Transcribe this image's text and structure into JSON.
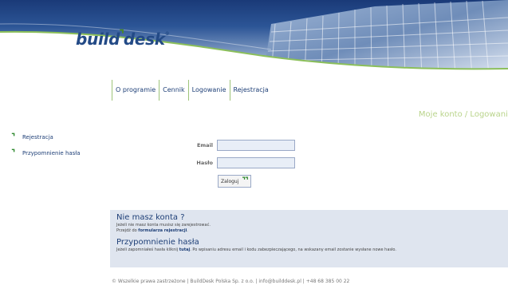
{
  "header": {
    "logo_main": "build",
    "logo_tail": "desk",
    "logo_reg": "®"
  },
  "nav": {
    "items": [
      "O programie",
      "Cennik",
      "Logowanie",
      "Rejestracja"
    ]
  },
  "breadcrumb": "Moje konto / Logowanie",
  "sidebar": {
    "items": [
      "Rejestracja",
      "Przypomnienie hasła"
    ]
  },
  "login": {
    "email_label": "Email",
    "email_value": "",
    "password_label": "Hasło",
    "password_value": "",
    "button_label": "Zaloguj"
  },
  "info": {
    "title1": "Nie masz konta ?",
    "text1": "Jeżeli nie masz konta musisz się zarejestrować.",
    "text2_prefix": "Przejdź do",
    "text2_link": "formularza rejestracji",
    "title2": "Przypomnienie hasła",
    "text3_prefix": "Jeżeli zapomniałeś hasła kliknij",
    "text3_link": "tutaj",
    "text3_suffix": ". Po wpisaniu adresu email i kodu zabezpieczającego, na wskazany email zostanie wysłane nowe hasło."
  },
  "footer": "© Wszelkie prawa zastrzeżone | BuildDesk Polska Sp. z o.o. | info@builddesk.pl | +48 68 385 00 22",
  "colors": {
    "brand_blue": "#234a86",
    "brand_green": "#4a8a2a",
    "panel_bg": "#dfe5ef",
    "breadcrumb": "#b9d48b"
  }
}
